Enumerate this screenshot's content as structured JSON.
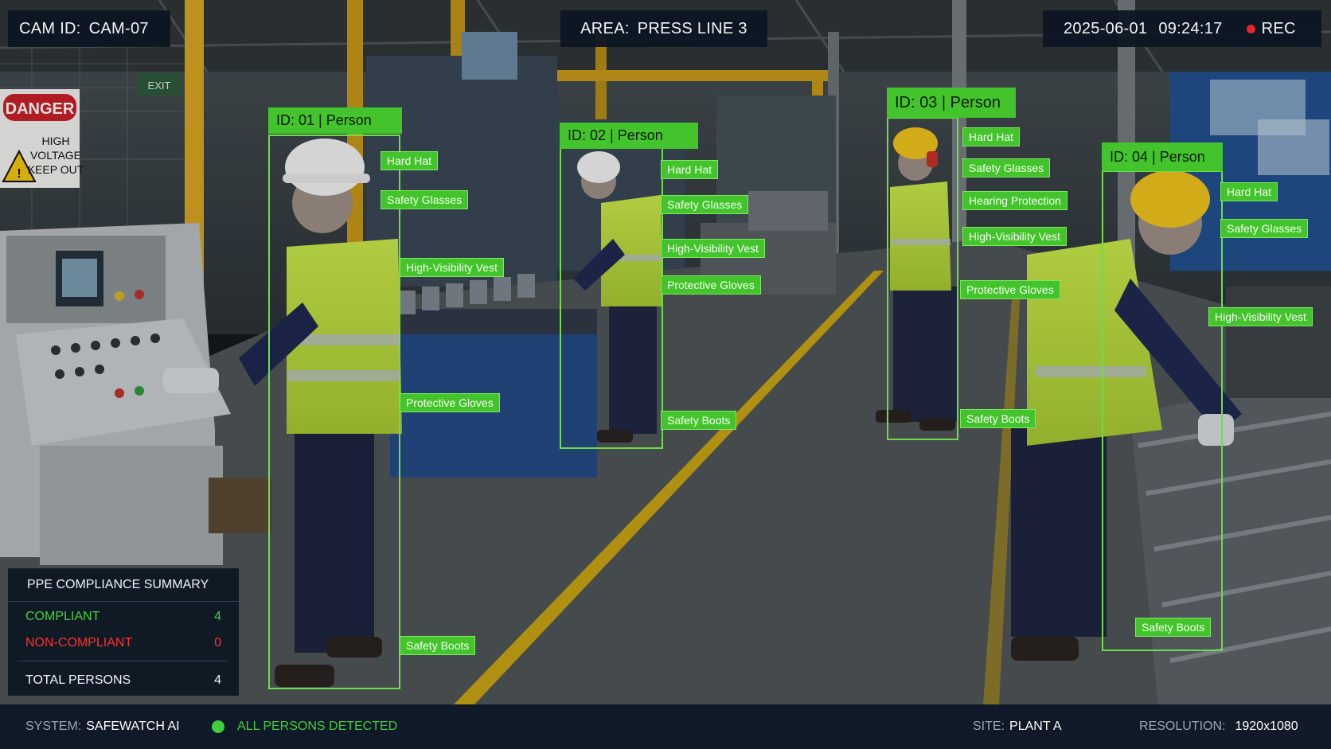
{
  "header": {
    "cam_label": "CAM ID:",
    "cam_value": "CAM-07",
    "area_label": "AREA:",
    "area_value": "PRESS LINE 3",
    "date": "2025-06-01",
    "time": "09:24:17",
    "rec_label": "REC",
    "rec_color": "#e0262b"
  },
  "scene": {
    "danger_sign": {
      "title": "DANGER",
      "lines": [
        "HIGH",
        "VOLTAGE",
        "KEEP OUT"
      ]
    },
    "wall_sign": "EXIT"
  },
  "detections": [
    {
      "title": "ID: 01 | Person",
      "tags": [
        "Hard Hat",
        "Safety Glasses",
        "High-Visibility Vest",
        "Protective Gloves",
        "Safety Boots"
      ]
    },
    {
      "title": "ID: 02 | Person",
      "tags": [
        "Hard Hat",
        "Safety Glasses",
        "High-Visibility Vest",
        "Protective Gloves",
        "Safety Boots"
      ]
    },
    {
      "title": "ID: 03 | Person",
      "tags": [
        "Hard Hat",
        "Safety Glasses",
        "Hearing Protection",
        "High-Visibility Vest",
        "Protective Gloves",
        "Safety Boots"
      ]
    },
    {
      "title": "ID: 04 | Person",
      "tags": [
        "Hard Hat",
        "Safety Glasses",
        "High-Visibility Vest",
        "Safety Boots"
      ]
    }
  ],
  "summary": {
    "title": "PPE COMPLIANCE SUMMARY",
    "compliant_label": "COMPLIANT",
    "compliant_value": "4",
    "noncompliant_label": "NON-COMPLIANT",
    "noncompliant_value": "0",
    "total_label": "TOTAL PERSONS",
    "total_value": "4",
    "compliant_color": "#41d13a",
    "noncompliant_color": "#ff3030"
  },
  "footer": {
    "system_label": "SYSTEM:",
    "system_value": "SAFEWATCH AI",
    "status_text": "ALL PERSONS DETECTED",
    "status_color": "#3fcf3a",
    "site_label": "SITE:",
    "site_value": "PLANT A",
    "resolution_label": "RESOLUTION:",
    "resolution_value": "1920x1080"
  },
  "colors": {
    "detection_box": "#6fdc4a",
    "detection_tag": "#44c42c",
    "overlay_panel": "#0c1622"
  }
}
